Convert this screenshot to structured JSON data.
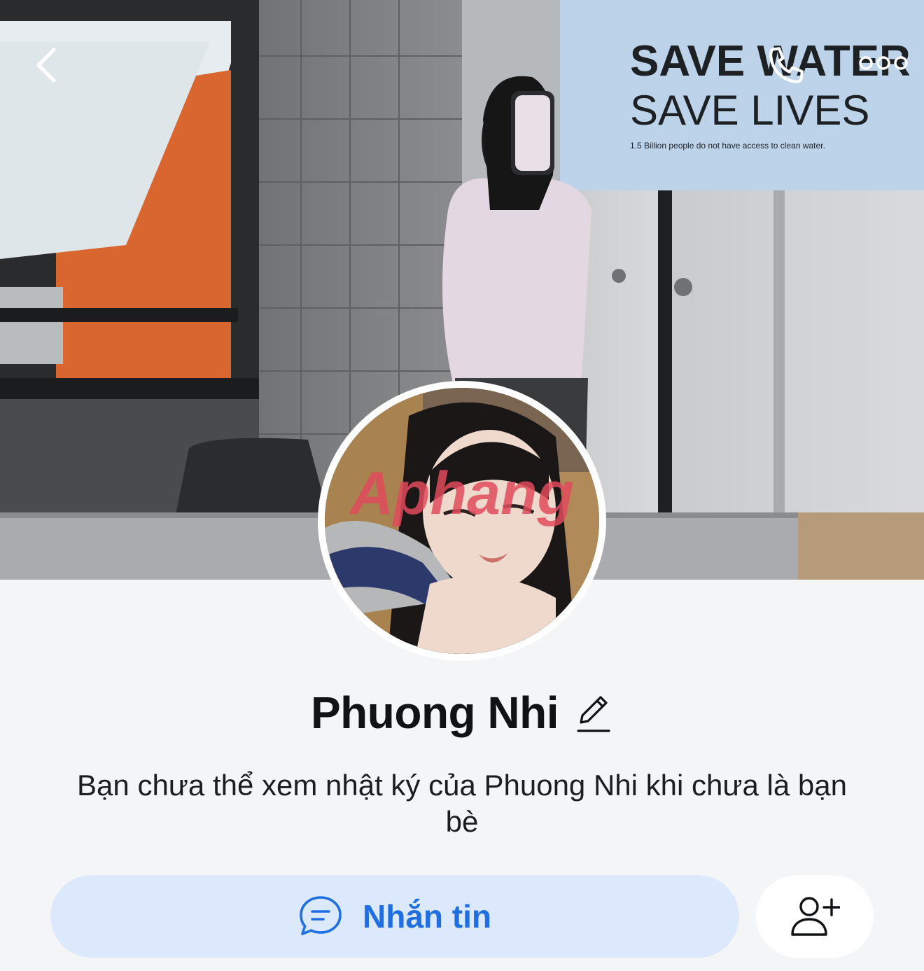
{
  "header": {
    "back_icon": "chevron-left-icon",
    "call_icon": "phone-icon",
    "more_icon": "more-horizontal-icon"
  },
  "cover": {
    "poster_line1": "SAVE WATER",
    "poster_line2": "SAVE LIVES",
    "poster_small": "1.5 Billion people do not have access to clean water."
  },
  "avatar": {
    "watermark": "Aphang"
  },
  "profile": {
    "name": "Phuong Nhi",
    "edit_icon": "pencil-icon"
  },
  "privacy_note": "Bạn chưa thể xem nhật ký của Phuong Nhi khi chưa là bạn bè",
  "actions": {
    "message_label": "Nhắn tin",
    "message_icon": "chat-bubble-icon",
    "add_friend_icon": "add-friend-icon"
  },
  "colors": {
    "accent": "#1f6fe3",
    "message_button_bg": "#dce8fc",
    "page_bg": "#f4f5f7"
  }
}
